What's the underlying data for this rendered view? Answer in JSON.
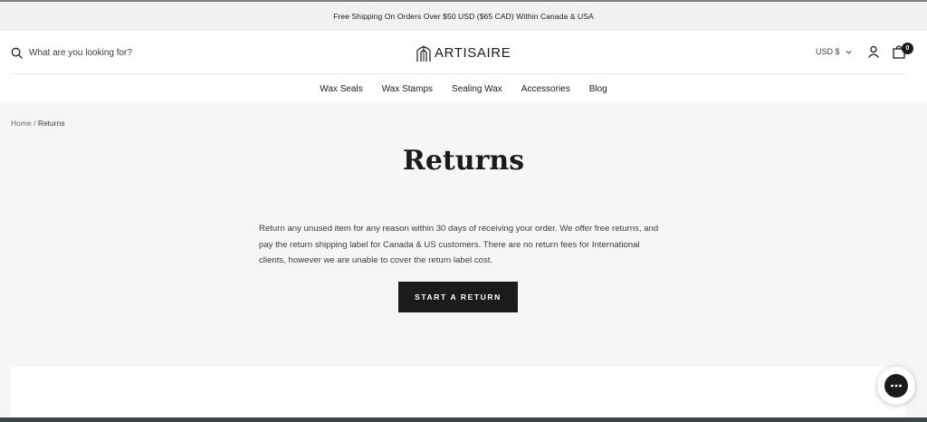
{
  "announcement": "Free Shipping On Orders Over $50 USD ($65 CAD) Within Canada & USA",
  "search": {
    "placeholder": "What are you looking for?",
    "icon": "search-icon"
  },
  "brand": {
    "name": "ARTISAIRE"
  },
  "currency": {
    "selected": "USD $"
  },
  "cart": {
    "count": "0"
  },
  "nav": {
    "items": [
      "Wax Seals",
      "Wax Stamps",
      "Sealing Wax",
      "Accessories",
      "Blog"
    ]
  },
  "breadcrumb": {
    "home": "Home",
    "separator": "/",
    "current": "Returns"
  },
  "page": {
    "title": "Returns",
    "body": "Return any unused item for any reason within 30 days of receiving your order. We offer free returns, and pay the return shipping label for Canada & US customers. There are no return fees for International clients, however we are unable to cover the return label cost.",
    "button": "START A RETURN"
  },
  "colors": {
    "accent": "#1c1b1b",
    "background": "#f7f6f4",
    "footer": "#3b4646"
  }
}
